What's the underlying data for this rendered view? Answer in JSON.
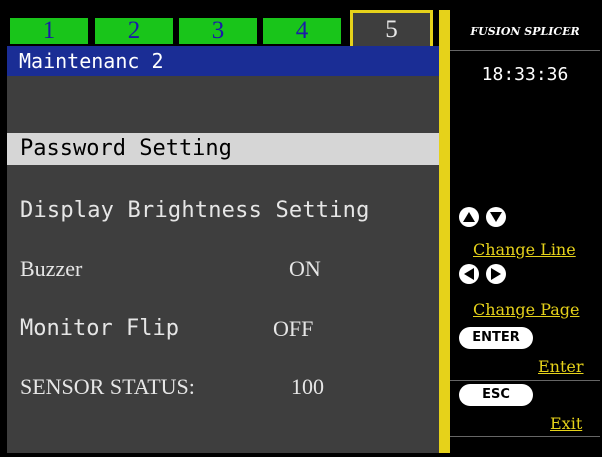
{
  "tabs": [
    "1",
    "2",
    "3",
    "4",
    "5"
  ],
  "active_tab": "5",
  "title": "Maintenanc 2",
  "menu": {
    "password": "Password Setting",
    "brightness": "Display Brightness Setting",
    "buzzer_label": "Buzzer",
    "buzzer_value": "ON",
    "flip_label": "Monitor Flip",
    "flip_value": "OFF",
    "sensor_label": "SENSOR STATUS:",
    "sensor_value": "100"
  },
  "sidebar": {
    "brand": "FUSION SPLICER",
    "time": "18:33:36",
    "change_line": "Change Line",
    "change_page": "Change Page",
    "enter_key": "ENTER",
    "enter_label": "Enter",
    "esc_key": "ESC",
    "exit_label": "Exit"
  },
  "icons": [
    "up-arrow-icon",
    "down-arrow-icon",
    "left-arrow-icon",
    "right-arrow-icon"
  ],
  "colors": {
    "tab_green": "#19c51a",
    "title_blue": "#1a2d95",
    "panel_gray": "#3e3e3e",
    "accent_yellow": "#e6d21a",
    "selected_gray": "#d6d6d6"
  }
}
